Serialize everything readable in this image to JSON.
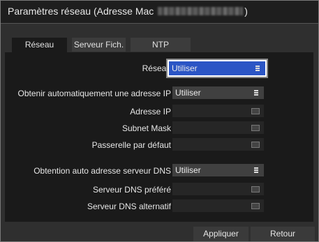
{
  "window": {
    "title_prefix": "Paramètres réseau (Adresse Mac ",
    "title_suffix": ")"
  },
  "tabs": [
    {
      "label": "Réseau"
    },
    {
      "label": "Serveur Fich."
    },
    {
      "label": "NTP"
    }
  ],
  "form": {
    "reseau": {
      "label": "Réseau",
      "value": "Utiliser"
    },
    "dhcp": {
      "label": "Obtenir automatiquement une adresse IP",
      "value": "Utiliser"
    },
    "ip": {
      "label": "Adresse IP",
      "value": ""
    },
    "mask": {
      "label": "Subnet Mask",
      "value": ""
    },
    "gateway": {
      "label": "Passerelle par défaut",
      "value": ""
    },
    "dns_auto": {
      "label": "Obtention auto adresse serveur DNS",
      "value": "Utiliser"
    },
    "dns_pref": {
      "label": "Serveur DNS préféré",
      "value": ""
    },
    "dns_alt": {
      "label": "Serveur DNS alternatif",
      "value": ""
    }
  },
  "buttons": {
    "apply": "Appliquer",
    "back": "Retour"
  },
  "colors": {
    "focus": "#2b55c5",
    "window_bg": "#2f2f2f",
    "panel_bg": "#1a1a1a"
  }
}
